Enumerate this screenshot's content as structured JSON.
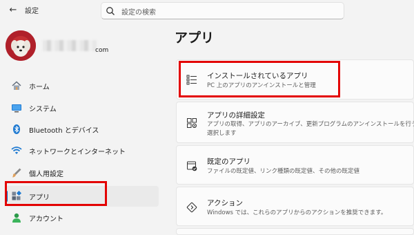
{
  "titlebar": {
    "back_glyph": "←",
    "app_title": "設定"
  },
  "search": {
    "placeholder": "設定の検索"
  },
  "profile": {
    "email_suffix": "com"
  },
  "sidebar": {
    "items": [
      {
        "label": "ホーム",
        "icon": "home-icon"
      },
      {
        "label": "システム",
        "icon": "system-monitor-icon"
      },
      {
        "label": "Bluetooth とデバイス",
        "icon": "bluetooth-icon"
      },
      {
        "label": "ネットワークとインターネット",
        "icon": "wifi-icon"
      },
      {
        "label": "個人用設定",
        "icon": "paintbrush-icon"
      },
      {
        "label": "アプリ",
        "icon": "apps-icon",
        "selected": true
      },
      {
        "label": "アカウント",
        "icon": "account-icon"
      }
    ]
  },
  "main": {
    "title": "アプリ",
    "cards": [
      {
        "title": "インストールされているアプリ",
        "sub": [
          "PC 上のアプリのアンインストールと管理"
        ],
        "icon": "list-icon"
      },
      {
        "title": "アプリの詳細設定",
        "sub": [
          "アプリの取得、アプリのアーカイブ、更新プログラムのアンインストールを行う場所を",
          "選択します"
        ],
        "icon": "advanced-settings-icon"
      },
      {
        "title": "既定のアプリ",
        "sub": [
          "ファイルの既定値、リンク種類の既定値、その他の既定値"
        ],
        "icon": "default-apps-icon"
      },
      {
        "title": "アクション",
        "sub": [
          "Windows では、これらのアプリからのアクションを推奨できます。"
        ],
        "icon": "actions-icon"
      }
    ]
  },
  "colors": {
    "accent": "#0067c0",
    "highlight": "#e30000",
    "avatar_bg": "#b0202a"
  }
}
